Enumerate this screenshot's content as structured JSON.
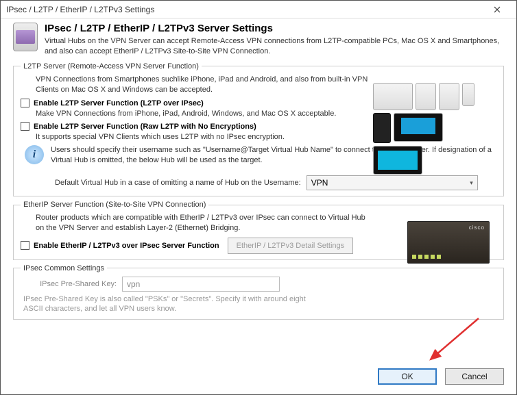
{
  "titlebar": {
    "text": "IPsec / L2TP / EtherIP / L2TPv3 Settings"
  },
  "header": {
    "title": "IPsec / L2TP / EtherIP / L2TPv3 Server Settings",
    "desc": "Virtual Hubs on the VPN Server can accept Remote-Access VPN connections from L2TP-compatible PCs, Mac OS X and Smartphones, and also can accept EtherIP / L2TPv3 Site-to-Site VPN Connection."
  },
  "l2tp": {
    "legend": "L2TP Server (Remote-Access VPN Server Function)",
    "desc": "VPN Connections from Smartphones suchlike iPhone, iPad and Android, and also from built-in VPN Clients on Mac OS X and Windows can be accepted.",
    "chk1_label": "Enable L2TP Server Function (L2TP over IPsec)",
    "chk1_sub": "Make VPN Connections from iPhone, iPad, Android, Windows, and Mac OS X acceptable.",
    "chk2_label": "Enable L2TP Server Function (Raw L2TP with No Encryptions)",
    "chk2_sub": "It supports special VPN Clients which uses L2TP with no IPsec encryption.",
    "info_text": "Users should specify their username such as \"Username@Target Virtual Hub Name\" to connect this L2TP Server. If designation of a Virtual Hub is omitted, the below Hub will be used as the target.",
    "hub_label": "Default Virtual Hub in a case of omitting a name of Hub on the Username:",
    "hub_value": "VPN"
  },
  "etherip": {
    "legend": "EtherIP Server Function (Site-to-Site VPN Connection)",
    "desc": "Router products which are compatible with EtherIP / L2TPv3 over IPsec can connect to Virtual Hub on the VPN Server and establish Layer-2 (Ethernet) Bridging.",
    "chk_label": "Enable EtherIP / L2TPv3 over IPsec Server Function",
    "detail_btn": "EtherIP / L2TPv3 Detail Settings",
    "brand": "cisco"
  },
  "ipsec": {
    "legend": "IPsec Common Settings",
    "psk_label": "IPsec Pre-Shared Key:",
    "psk_value": "vpn",
    "psk_note": "IPsec Pre-Shared Key is also called \"PSKs\" or \"Secrets\". Specify it with around eight ASCII characters, and let all VPN users know."
  },
  "footer": {
    "ok": "OK",
    "cancel": "Cancel"
  }
}
